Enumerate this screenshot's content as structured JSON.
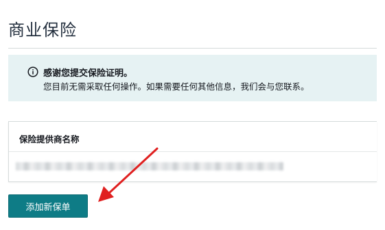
{
  "page": {
    "title": "商业保险"
  },
  "alert": {
    "icon": "info-circle-icon",
    "title": "感谢您提交保险证明。",
    "body": "您目前无需采取任何操作。如果需要任何其他信息，我们会与您联系。"
  },
  "table": {
    "header": "保险提供商名称"
  },
  "actions": {
    "add_label": "添加新保单"
  },
  "colors": {
    "accent": "#0e7c86",
    "alert_background": "#e6f2f3",
    "annotation_arrow": "#e02020"
  }
}
